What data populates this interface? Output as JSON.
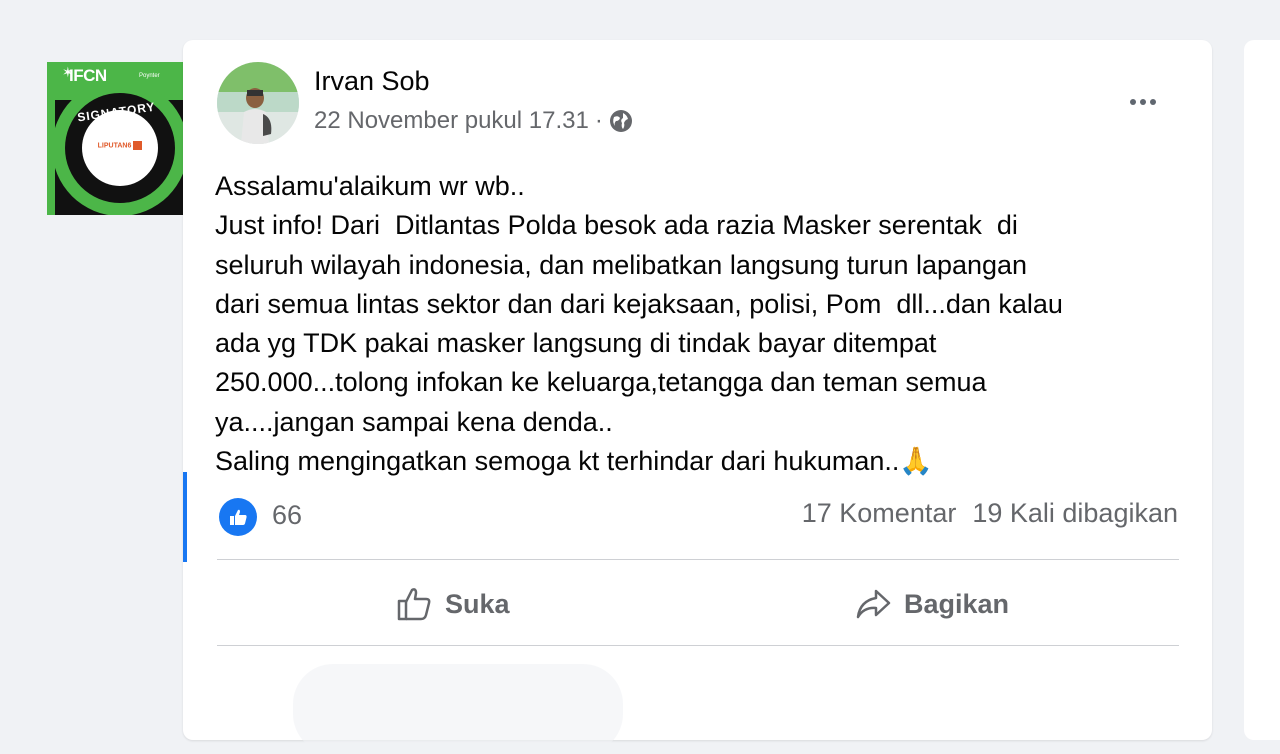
{
  "badge": {
    "logo": "IFCN",
    "logo_small": "Poynter",
    "ring_text": "SIGNATORY",
    "core_text": "LIPUTAN6"
  },
  "post": {
    "author": "Irvan Sob",
    "timestamp": "22 November pukul 17.31",
    "separator": "·",
    "privacy_icon": "globe-icon",
    "lines": [
      "Assalamu'alaikum wr wb..",
      "Just info! Dari  Ditlantas Polda besok ada razia Masker serentak  di",
      "seluruh wilayah indonesia, dan melibatkan langsung turun lapangan",
      "dari semua lintas sektor dan dari kejaksaan, polisi, Pom  dll...dan kalau",
      "ada yg TDK pakai masker langsung di tindak bayar ditempat",
      "250.000...tolong infokan ke keluarga,tetangga dan teman semua",
      "ya....jangan sampai kena denda..",
      "Saling mengingatkan semoga kt terhindar dari hukuman.."
    ],
    "emoji": "🙏",
    "reactions": "66",
    "comments": "17 Komentar",
    "shares": "19 Kali dibagikan",
    "actions": {
      "like": "Suka",
      "share": "Bagikan"
    }
  },
  "colors": {
    "accent": "#1877f2",
    "muted_text": "#65676b",
    "ifcn_green": "#4cb648"
  }
}
